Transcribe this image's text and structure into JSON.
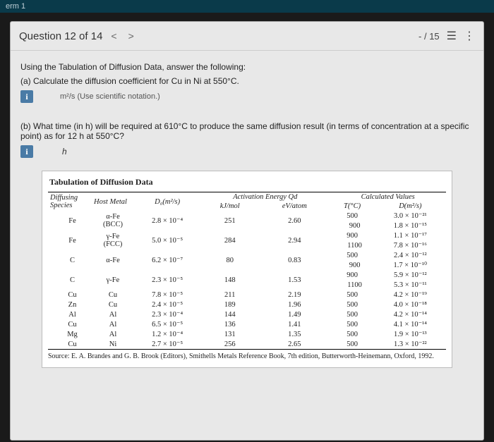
{
  "topStrip": "erm 1",
  "header": {
    "qTitle": "Question 12 of 14",
    "prevChev": "<",
    "nextChev": ">",
    "score": "- / 15"
  },
  "content": {
    "intro": "Using the Tabulation of Diffusion Data, answer the following:",
    "partA": "(a) Calculate the diffusion coefficient for Cu in Ni at 550°C.",
    "unitsA": "m²/s (Use scientific notation.)",
    "partB": "(b) What time (in h) will be required at 610°C to produce the same diffusion result (in terms of concentration at a specific point) as for 12 h at 550°C?",
    "hvar": "h"
  },
  "table": {
    "title": "Tabulation of Diffusion Data",
    "headers": {
      "species": "Diffusing Species",
      "host": "Host Metal",
      "d0": "D₀(m²/s)",
      "actGroup": "Activation Energy Qd",
      "kjmol": "kJ/mol",
      "evatom": "eV/atom",
      "calcGroup": "Calculated Values",
      "tc": "T(°C)",
      "dm": "D(m²/s)"
    },
    "rows": [
      {
        "sp": "Fe",
        "host": "α-Fe (BCC)",
        "d0": "2.8 × 10⁻⁴",
        "kj": "251",
        "ev": "2.60",
        "calc": [
          [
            "500",
            "3.0 × 10⁻²¹"
          ],
          [
            "900",
            "1.8 × 10⁻¹⁵"
          ]
        ]
      },
      {
        "sp": "Fe",
        "host": "γ-Fe (FCC)",
        "d0": "5.0 × 10⁻⁵",
        "kj": "284",
        "ev": "2.94",
        "calc": [
          [
            "900",
            "1.1 × 10⁻¹⁷"
          ],
          [
            "1100",
            "7.8 × 10⁻¹⁶"
          ]
        ]
      },
      {
        "sp": "C",
        "host": "α-Fe",
        "d0": "6.2 × 10⁻⁷",
        "kj": "80",
        "ev": "0.83",
        "calc": [
          [
            "500",
            "2.4 × 10⁻¹²"
          ],
          [
            "900",
            "1.7 × 10⁻¹⁰"
          ]
        ]
      },
      {
        "sp": "C",
        "host": "γ-Fe",
        "d0": "2.3 × 10⁻⁵",
        "kj": "148",
        "ev": "1.53",
        "calc": [
          [
            "900",
            "5.9 × 10⁻¹²"
          ],
          [
            "1100",
            "5.3 × 10⁻¹¹"
          ]
        ]
      },
      {
        "sp": "Cu",
        "host": "Cu",
        "d0": "7.8 × 10⁻⁵",
        "kj": "211",
        "ev": "2.19",
        "calc": [
          [
            "500",
            "4.2 × 10⁻¹⁹"
          ]
        ]
      },
      {
        "sp": "Zn",
        "host": "Cu",
        "d0": "2.4 × 10⁻⁵",
        "kj": "189",
        "ev": "1.96",
        "calc": [
          [
            "500",
            "4.0 × 10⁻¹⁸"
          ]
        ]
      },
      {
        "sp": "Al",
        "host": "Al",
        "d0": "2.3 × 10⁻⁴",
        "kj": "144",
        "ev": "1.49",
        "calc": [
          [
            "500",
            "4.2 × 10⁻¹⁴"
          ]
        ]
      },
      {
        "sp": "Cu",
        "host": "Al",
        "d0": "6.5 × 10⁻⁵",
        "kj": "136",
        "ev": "1.41",
        "calc": [
          [
            "500",
            "4.1 × 10⁻¹⁴"
          ]
        ]
      },
      {
        "sp": "Mg",
        "host": "Al",
        "d0": "1.2 × 10⁻⁴",
        "kj": "131",
        "ev": "1.35",
        "calc": [
          [
            "500",
            "1.9 × 10⁻¹³"
          ]
        ]
      },
      {
        "sp": "Cu",
        "host": "Ni",
        "d0": "2.7 × 10⁻⁵",
        "kj": "256",
        "ev": "2.65",
        "calc": [
          [
            "500",
            "1.3 × 10⁻²²"
          ]
        ]
      }
    ],
    "source": "Source: E. A. Brandes and G. B. Brook (Editors), Smithells Metals Reference Book, 7th edition, Butterworth-Heinemann, Oxford, 1992."
  }
}
